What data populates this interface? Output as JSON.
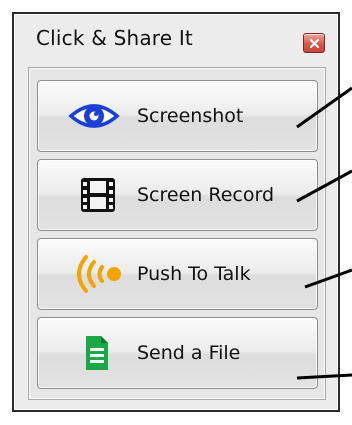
{
  "window": {
    "title": "Click & Share It",
    "close_icon": "close-icon"
  },
  "buttons": [
    {
      "label": "Screenshot",
      "icon": "eye-icon",
      "icon_color": "#1c3fd6"
    },
    {
      "label": "Screen Record",
      "icon": "film-strip-icon",
      "icon_color": "#111111"
    },
    {
      "label": "Push To Talk",
      "icon": "broadcast-icon",
      "icon_color": "#f5a300"
    },
    {
      "label": "Send a File",
      "icon": "document-icon",
      "icon_color": "#1aa845"
    }
  ],
  "colors": {
    "window_background": "#ececec",
    "close_button": "#d9584a"
  }
}
